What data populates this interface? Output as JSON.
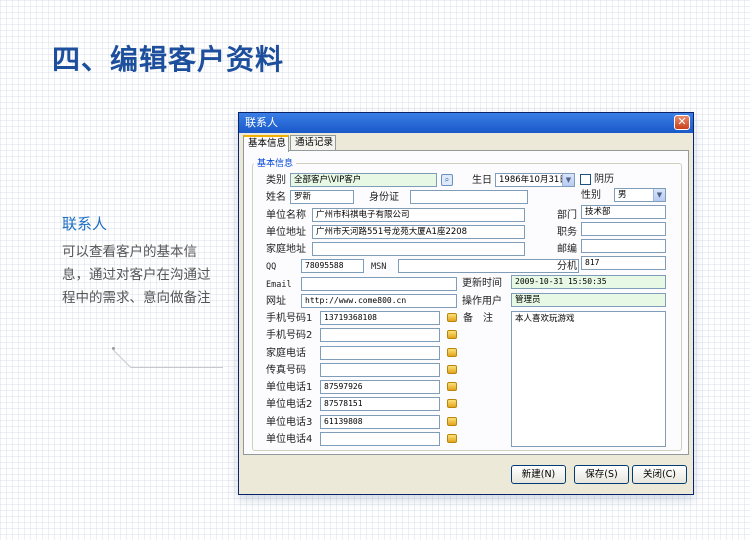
{
  "page": {
    "title": "四、编辑客户资料",
    "side_title": "联系人",
    "side_desc": "可以查看客户的基本信息，通过对客户在沟通过程中的需求、意向做备注"
  },
  "window": {
    "title": "联系人",
    "close": "✕",
    "tabs": [
      "基本信息",
      "通话记录"
    ],
    "group_title": "基本信息"
  },
  "form": {
    "category_label": "类别",
    "category_value": "全部客户\\VIP客户",
    "birthday_label": "生日",
    "birthday_value": "1986年10月31日",
    "lunar_label": "阴历",
    "gender_label": "性别",
    "gender_value": "男",
    "name_label": "姓名",
    "name_value": "罗新",
    "id_label": "身份证",
    "id_value": "",
    "company_label": "单位名称",
    "company_value": "广州市科祺电子有限公司",
    "department_label": "部门",
    "department_value": "技术部",
    "company_address_label": "单位地址",
    "company_address_value": "广州市天河路551号龙苑大厦A1座2208",
    "title_label": "职务",
    "title_value": "",
    "home_address_label": "家庭地址",
    "home_address_value": "",
    "postcode_label": "邮编",
    "postcode_value": "",
    "qq_label": "QQ",
    "qq_value": "78095588",
    "msn_label": "MSN",
    "msn_value": "",
    "ext_label": "分机",
    "ext_value": "817",
    "email_label": "Email",
    "email_value": "",
    "updated_label": "更新时间",
    "updated_value": "2009-10-31 15:50:35",
    "website_label": "网址",
    "website_value": "http://www.come800.cn",
    "operator_label": "操作用户",
    "operator_value": "管理员",
    "mobile1_label": "手机号码1",
    "mobile1_value": "13719368108",
    "mobile2_label": "手机号码2",
    "mobile2_value": "",
    "home_phone_label": "家庭电话",
    "home_phone_value": "",
    "fax_label": "传真号码",
    "fax_value": "",
    "work_phone1_label": "单位电话1",
    "work_phone1_value": "87597926",
    "work_phone2_label": "单位电话2",
    "work_phone2_value": "87578151",
    "work_phone3_label": "单位电话3",
    "work_phone3_value": "61139808",
    "work_phone4_label": "单位电话4",
    "work_phone4_value": "",
    "remarks_label": "备　注",
    "remarks_value": "本人喜欢玩游戏"
  },
  "buttons": {
    "new": "新建(N)",
    "save": "保存(S)",
    "close": "关闭(C)"
  },
  "icons": {
    "dropdown": "▼",
    "lookup": "⌕"
  }
}
